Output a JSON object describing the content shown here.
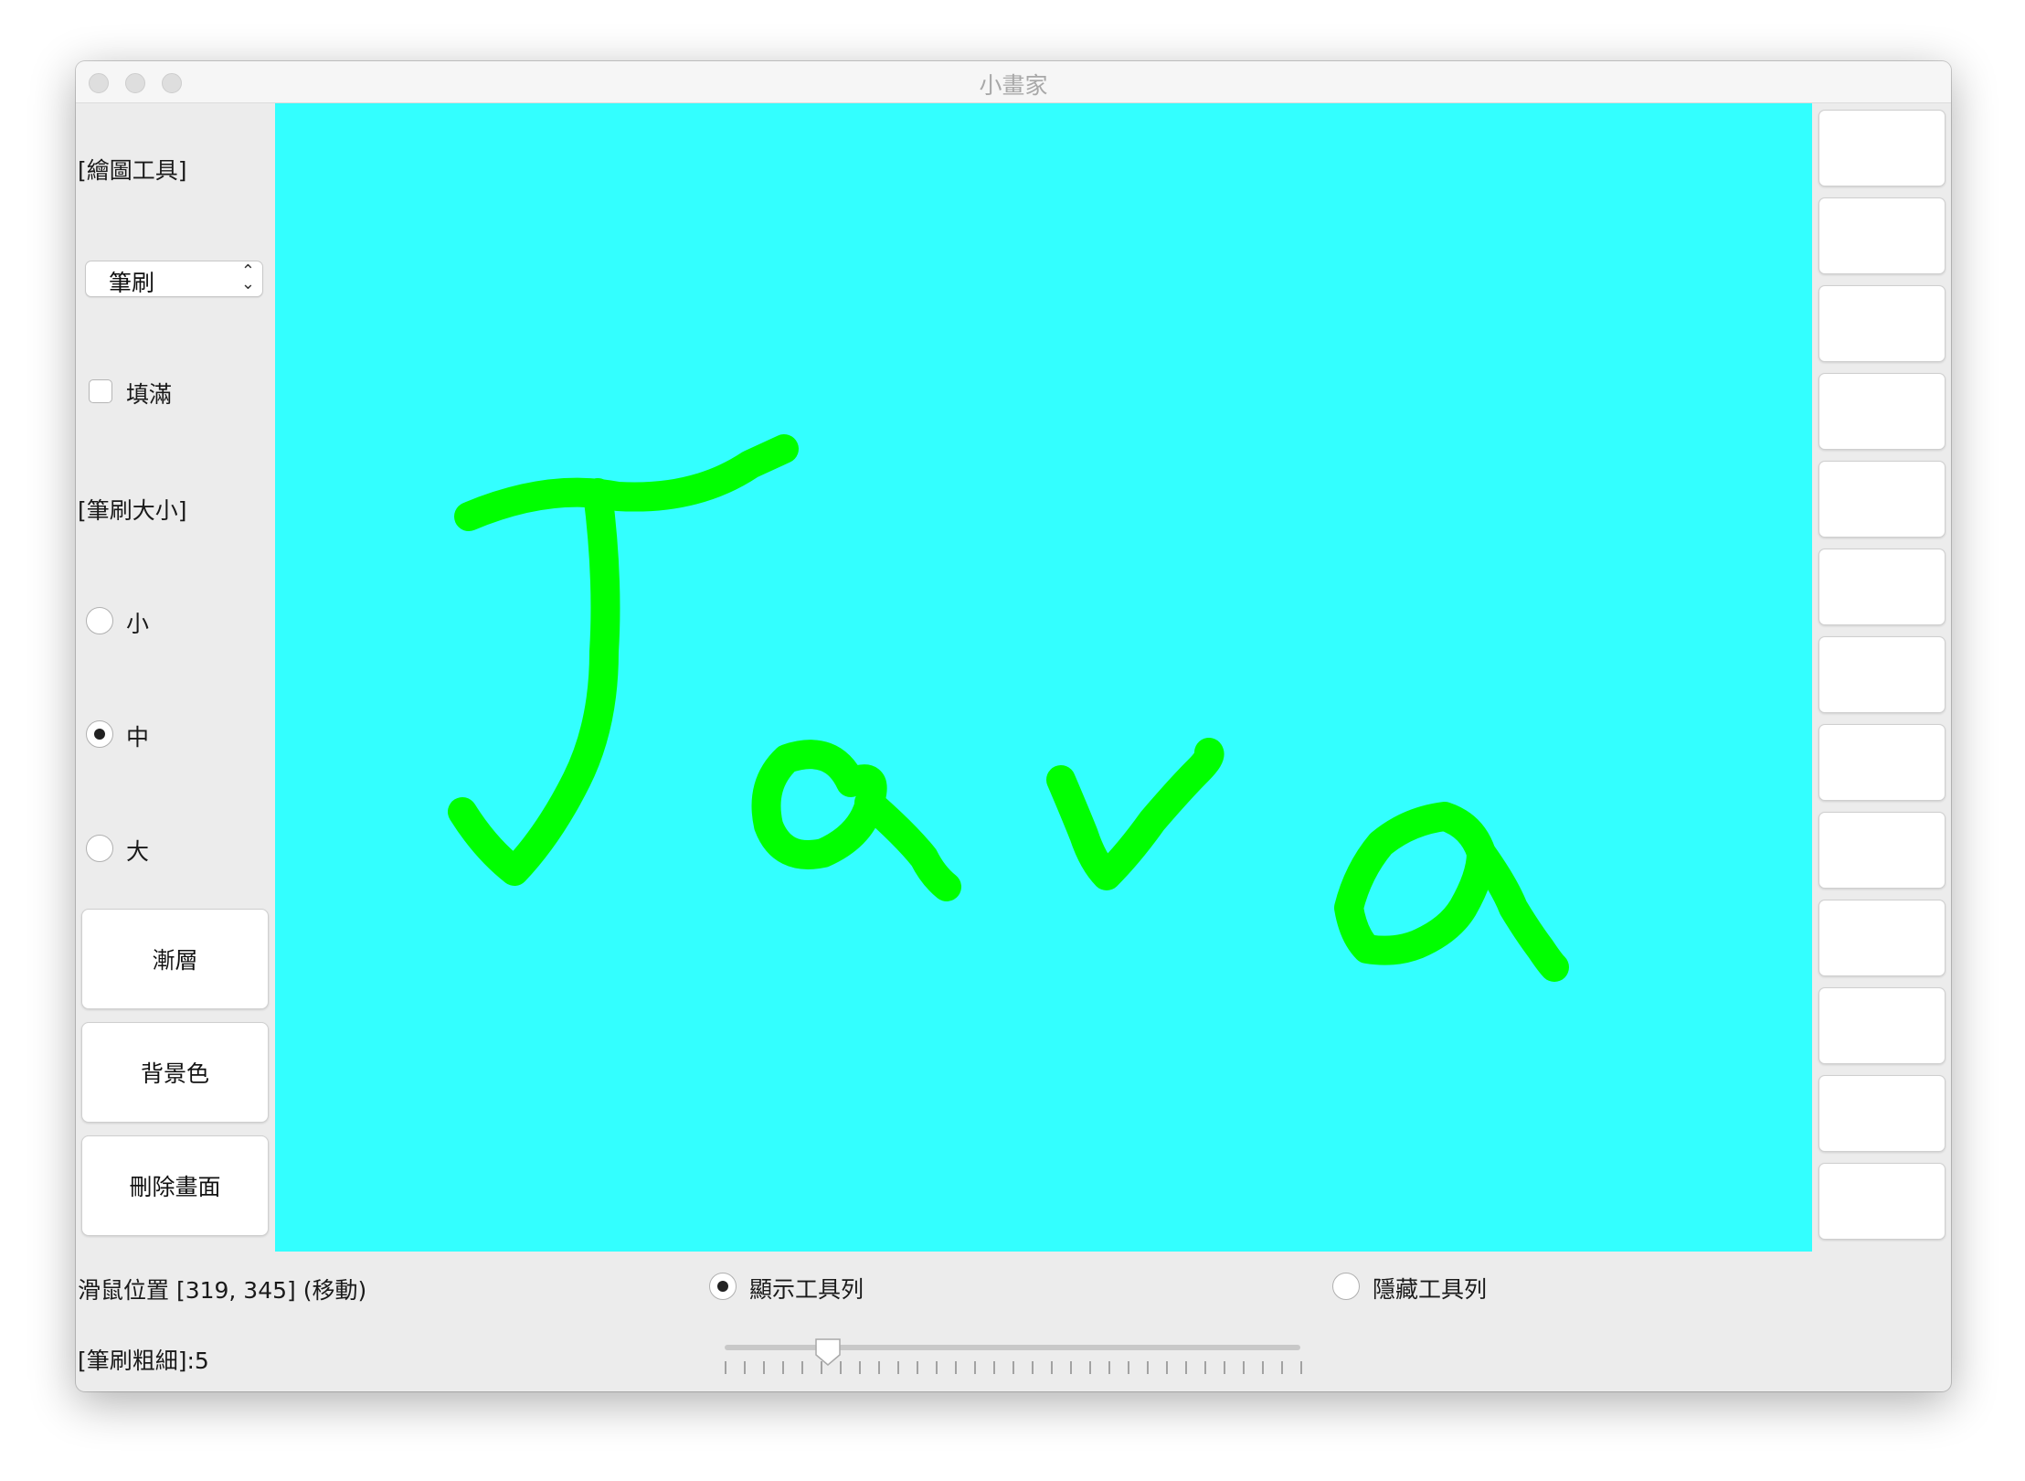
{
  "window": {
    "title": "小畫家"
  },
  "left_panel": {
    "tools_label": "[繪圖工具]",
    "tool_select": {
      "selected": "筆刷"
    },
    "fill_checkbox": {
      "label": "填滿",
      "checked": false
    },
    "brush_size_label": "[筆刷大小]",
    "sizes": [
      {
        "label": "小",
        "selected": false
      },
      {
        "label": "中",
        "selected": true
      },
      {
        "label": "大",
        "selected": false
      }
    ],
    "buttons": {
      "gradient": "漸層",
      "background_color": "背景色",
      "clear": "刪除畫面"
    }
  },
  "canvas": {
    "background": "#33ffff",
    "stroke_color": "#00ff00",
    "drawing_text": "Java"
  },
  "palette": {
    "swatch_count": 13,
    "swatch_color": "#ffffff"
  },
  "status": {
    "mouse_position": "滑鼠位置 [319, 345] (移動)",
    "show_toolbar": {
      "label": "顯示工具列",
      "selected": true
    },
    "hide_toolbar": {
      "label": "隱藏工具列",
      "selected": false
    },
    "thickness_label": "[筆刷粗細]:5"
  },
  "thickness_slider": {
    "value": 5,
    "min": 0,
    "max": 30,
    "tick_count": 31
  }
}
